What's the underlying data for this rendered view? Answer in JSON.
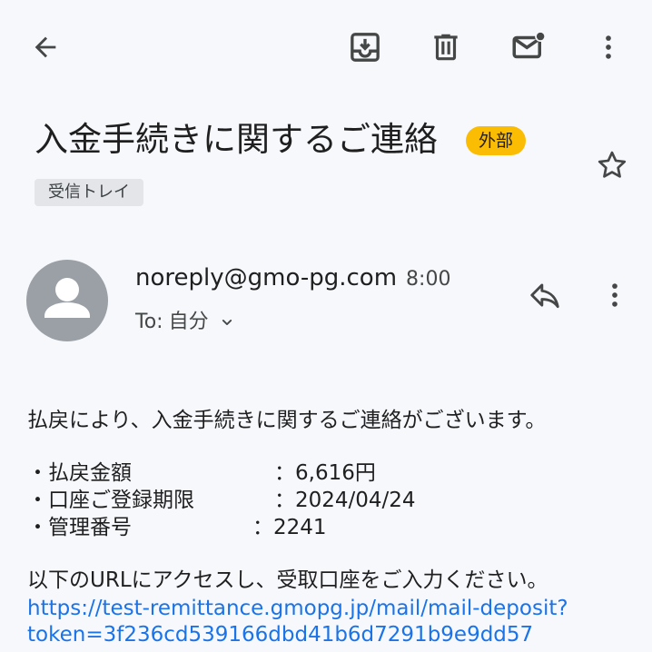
{
  "toolbar": {
    "back_icon": "arrow-back-icon",
    "archive_icon": "archive-icon",
    "delete_icon": "trash-icon",
    "unread_icon": "mark-unread-mail-icon",
    "more_icon": "more-vert-icon"
  },
  "email": {
    "subject": "入金手続きに関するご連絡",
    "external_badge": "外部",
    "label": "受信トレイ",
    "starred": false
  },
  "sender": {
    "address": "noreply@gmo-pg.com",
    "time": "8:00",
    "to_prefix": "To: ",
    "to_value": "自分"
  },
  "body": {
    "intro": "払戻により、入金手続きに関するご連絡がございます。",
    "details": [
      {
        "label": "・払戻金額",
        "value": "：6,616円"
      },
      {
        "label": "・口座ご登録期限",
        "value": "：2024/04/24"
      },
      {
        "label": "・管理番号",
        "value": "：2241"
      }
    ],
    "instruction": "以下のURLにアクセスし、受取口座をご入力ください。",
    "link_line1": "https://test-remittance.gmopg.jp/mail/mail-deposit?",
    "link_line2": "token=3f236cd539166dbd41b6d7291b9e9dd57"
  },
  "colors": {
    "background": "#f6f8fc",
    "badge": "#fbbc04",
    "link": "#1a73e8",
    "avatar": "#9aa0a6",
    "icon": "#444746"
  }
}
